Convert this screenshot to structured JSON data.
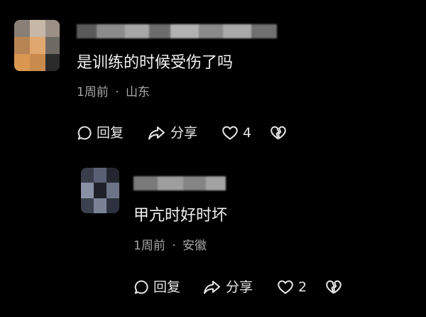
{
  "comments": [
    {
      "text": "是训练的时候受伤了吗",
      "time": "1周前",
      "separator": "·",
      "location": "山东",
      "actions": {
        "reply_label": "回复",
        "share_label": "分享",
        "like_count": "4"
      }
    },
    {
      "text": "甲亢时好时坏",
      "time": "1周前",
      "separator": "·",
      "location": "安徽",
      "actions": {
        "reply_label": "回复",
        "share_label": "分享",
        "like_count": "2"
      }
    }
  ],
  "icons": {
    "reply": "comment-bubble-icon",
    "share": "share-arrow-icon",
    "like": "heart-outline-icon",
    "dislike": "broken-heart-icon"
  },
  "colors": {
    "background": "#000000",
    "text": "#f2f2f2",
    "meta": "#a7a7a7",
    "icon": "#e6e6e6"
  }
}
